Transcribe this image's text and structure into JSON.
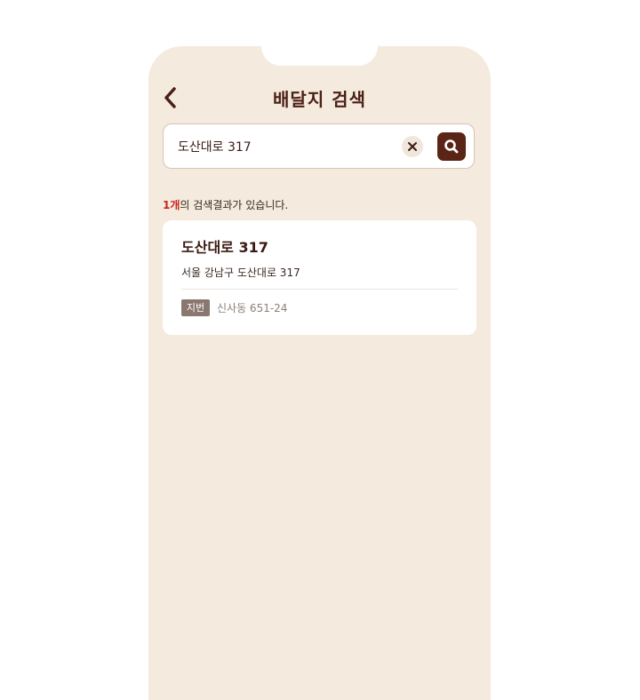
{
  "header": {
    "title": "배달지 검색",
    "back_icon": "chevron-left-icon"
  },
  "search": {
    "value": "도산대로 317",
    "clear_icon": "close-icon",
    "search_icon": "search-icon"
  },
  "results": {
    "count": "1개",
    "count_suffix": "의 검색결과가 있습니다.",
    "items": [
      {
        "title": "도산대로 317",
        "address": "서울 강남구 도산대로 317",
        "lot_label": "지번",
        "lot_address": "신사동 651-24"
      }
    ]
  },
  "colors": {
    "background": "#f4eadd",
    "accent": "#5a2416",
    "highlight": "#c8261a"
  }
}
